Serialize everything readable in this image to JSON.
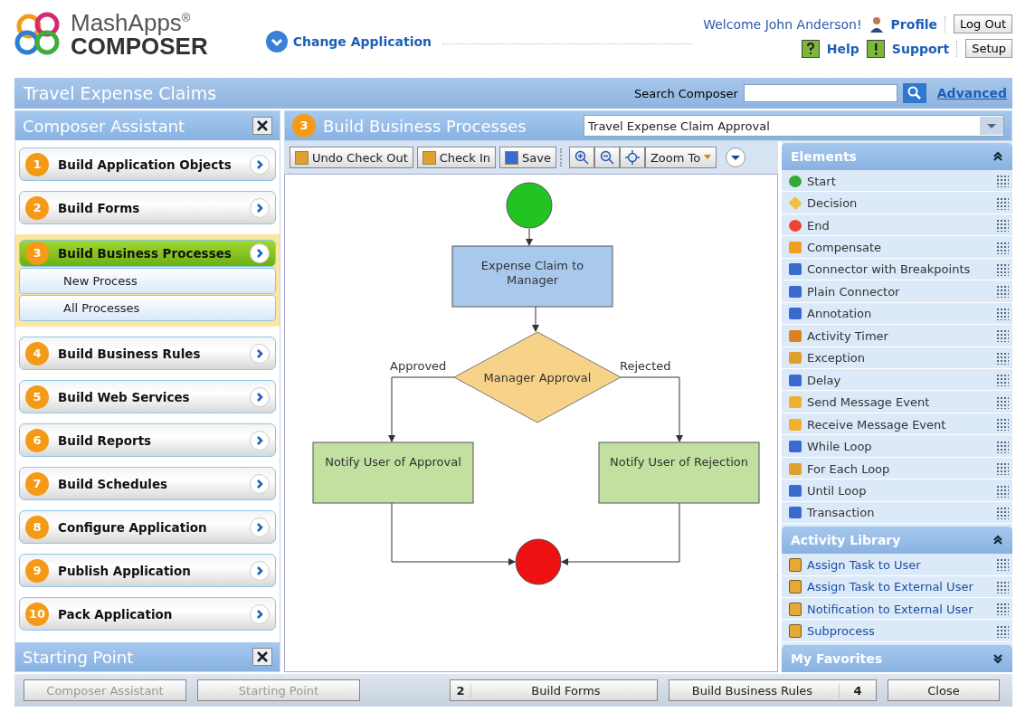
{
  "logo": {
    "name": "MashApps",
    "mark": "®",
    "product": "COMPOSER"
  },
  "change_application": "Change Application",
  "user": {
    "welcome": "Welcome John Anderson!",
    "profile": "Profile",
    "logout": "Log Out",
    "help": "Help",
    "support": "Support",
    "setup": "Setup"
  },
  "app_title": "Travel Expense Claims",
  "search": {
    "label": "Search Composer",
    "advanced": "Advanced"
  },
  "assistant": {
    "title": "Composer Assistant",
    "steps": [
      {
        "number": "1",
        "label": "Build Application Objects",
        "selected": false
      },
      {
        "number": "2",
        "label": "Build Forms",
        "selected": false
      },
      {
        "number": "3",
        "label": "Build Business Processes",
        "selected": true,
        "children": [
          "New Process",
          "All Processes"
        ]
      },
      {
        "number": "4",
        "label": "Build Business Rules",
        "selected": false
      },
      {
        "number": "5",
        "label": "Build Web Services",
        "selected": false
      },
      {
        "number": "6",
        "label": "Build Reports",
        "selected": false
      },
      {
        "number": "7",
        "label": "Build Schedules",
        "selected": false
      },
      {
        "number": "8",
        "label": "Configure Application",
        "selected": false
      },
      {
        "number": "9",
        "label": "Publish Application",
        "selected": false
      },
      {
        "number": "10",
        "label": "Pack Application",
        "selected": false
      }
    ]
  },
  "starting_point": {
    "title": "Starting Point"
  },
  "process_header": {
    "number": "3",
    "title": "Build Business Processes",
    "process": "Travel Expense Claim Approval"
  },
  "toolbar": [
    "Undo Check Out",
    "Check In",
    "Save"
  ],
  "zoom_to": "Zoom To",
  "diagram": {
    "nodes": [
      {
        "kind": "start"
      },
      {
        "kind": "task",
        "text": "Expense Claim to Manager",
        "color": "#a9c9ec"
      },
      {
        "kind": "decision",
        "text": "Manager Approval"
      },
      {
        "kind": "task",
        "text": "Notify User of Approval",
        "color": "#c3e0a0"
      },
      {
        "kind": "task",
        "text": "Notify User of Rejection",
        "color": "#c3e0a0"
      },
      {
        "kind": "end"
      }
    ],
    "edge_labels": [
      "Approved",
      "Rejected"
    ]
  },
  "palette": [
    {
      "title": "Elements",
      "expanded": true,
      "kind": "plain",
      "items": [
        "Start",
        "Decision",
        "End",
        "Compensate",
        "Connector with Breakpoints",
        "Plain Connector",
        "Annotation",
        "Activity Timer",
        "Exception",
        "Delay",
        "Send Message Event",
        "Receive Message Event",
        "While Loop",
        "For Each Loop",
        "Until Loop",
        "Transaction"
      ]
    },
    {
      "title": "Activity Library",
      "expanded": true,
      "kind": "link",
      "items": [
        "Assign Task to User",
        "Assign Task to External User",
        "Notification to External User",
        "Subprocess"
      ]
    },
    {
      "title": "My Favorites",
      "expanded": false
    }
  ],
  "footer": {
    "panels": [
      {
        "label": "Composer Assistant",
        "disabled": true
      },
      {
        "label": "Starting Point",
        "disabled": true
      }
    ],
    "previous": {
      "number": "2",
      "label": "Build Forms"
    },
    "next": {
      "label": "Build Business Rules",
      "number": "4"
    },
    "close": "Close"
  }
}
